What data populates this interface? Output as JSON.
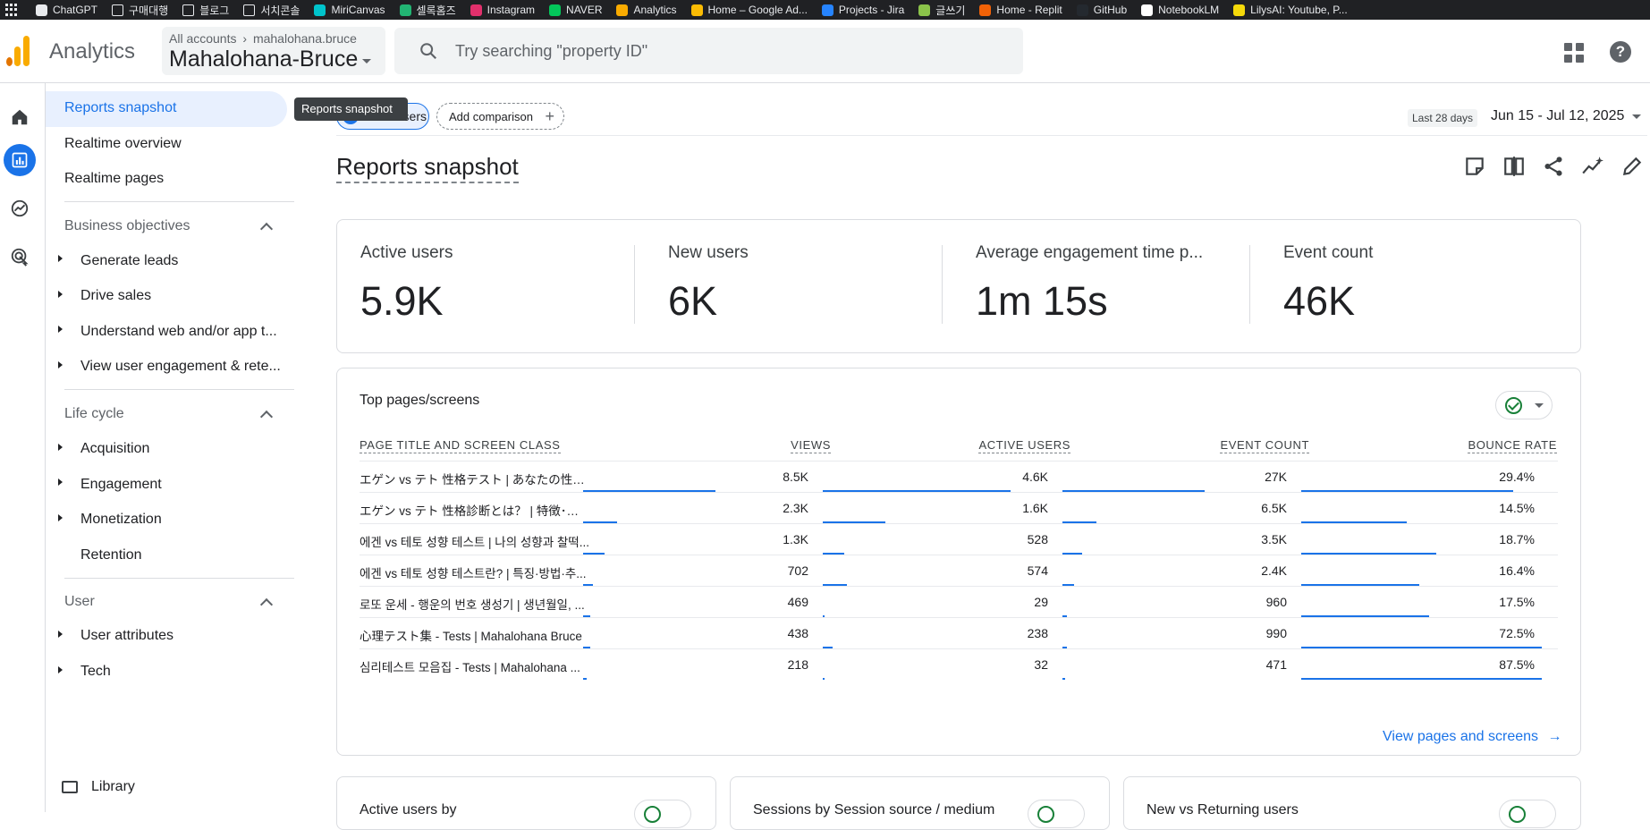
{
  "bookmarks": [
    {
      "label": "ChatGPT",
      "color": "#e8eaed",
      "folder": false
    },
    {
      "label": "구매대행",
      "color": "",
      "folder": true
    },
    {
      "label": "블로그",
      "color": "",
      "folder": true
    },
    {
      "label": "서치콘솔",
      "color": "",
      "folder": true
    },
    {
      "label": "MiriCanvas",
      "color": "#00c4cc",
      "folder": false
    },
    {
      "label": "셀록홈즈",
      "color": "#22b573",
      "folder": false
    },
    {
      "label": "Instagram",
      "color": "#e1306c",
      "folder": false
    },
    {
      "label": "NAVER",
      "color": "#03c75a",
      "folder": false
    },
    {
      "label": "Analytics",
      "color": "#f9ab00",
      "folder": false
    },
    {
      "label": "Home – Google Ad...",
      "color": "#fbbc04",
      "folder": false
    },
    {
      "label": "Projects - Jira",
      "color": "#2684ff",
      "folder": false
    },
    {
      "label": "글쓰기",
      "color": "#8bc34a",
      "folder": false
    },
    {
      "label": "Home - Replit",
      "color": "#f26207",
      "folder": false
    },
    {
      "label": "GitHub",
      "color": "#24292f",
      "folder": false
    },
    {
      "label": "NotebookLM",
      "color": "#ffffff",
      "folder": false
    },
    {
      "label": "LilysAI: Youtube, P...",
      "color": "#f5d90a",
      "folder": false
    }
  ],
  "header": {
    "app_name": "Analytics",
    "account_path": "All accounts",
    "account_sub": "mahalohana.bruce",
    "property_name": "Mahalohana-Bruce",
    "search_placeholder": "Try searching \"property ID\""
  },
  "nav": {
    "top_items": [
      "Reports snapshot",
      "Realtime overview",
      "Realtime pages"
    ],
    "business_objectives": {
      "title": "Business objectives",
      "items": [
        "Generate leads",
        "Drive sales",
        "Understand web and/or app t...",
        "View user engagement & rete..."
      ]
    },
    "life_cycle": {
      "title": "Life cycle",
      "items": [
        "Acquisition",
        "Engagement",
        "Monetization",
        "Retention"
      ]
    },
    "user": {
      "title": "User",
      "items": [
        "User attributes",
        "Tech"
      ]
    },
    "library": "Library",
    "tooltip": "Reports snapshot"
  },
  "toolbar": {
    "all_users_chip": "All Users",
    "add_comparison": "Add comparison",
    "date_label": "Last 28 days",
    "date_range": "Jun 15 - Jul 12, 2025"
  },
  "page_title": "Reports snapshot",
  "metrics": [
    {
      "label": "Active users",
      "value": "5.9K"
    },
    {
      "label": "New users",
      "value": "6K"
    },
    {
      "label": "Average engagement time p...",
      "value": "1m 15s"
    },
    {
      "label": "Event count",
      "value": "46K"
    }
  ],
  "top_pages": {
    "title": "Top pages/screens",
    "columns": [
      "PAGE TITLE AND SCREEN CLASS",
      "VIEWS",
      "ACTIVE USERS",
      "EVENT COUNT",
      "BOUNCE RATE"
    ],
    "rows": [
      {
        "title": "エゲン vs テト 性格テスト | あなたの性格と...",
        "views": "8.5K",
        "active_users": "4.6K",
        "event_count": "27K",
        "bounce_rate": "29.4%",
        "bars": [
          0.55,
          0.78,
          0.59,
          0.88
        ]
      },
      {
        "title": "エゲン vs テト 性格診断とは？ | 特徴･やり...",
        "views": "2.3K",
        "active_users": "1.6K",
        "event_count": "6.5K",
        "bounce_rate": "14.5%",
        "bars": [
          0.14,
          0.26,
          0.14,
          0.44
        ]
      },
      {
        "title": "에겐 vs 테토 성향 테스트 | 나의 성향과 찰떡...",
        "views": "1.3K",
        "active_users": "528",
        "event_count": "3.5K",
        "bounce_rate": "18.7%",
        "bars": [
          0.09,
          0.09,
          0.08,
          0.56
        ]
      },
      {
        "title": "에겐 vs 테토 성향 테스트란? | 특징·방법·추...",
        "views": "702",
        "active_users": "574",
        "event_count": "2.4K",
        "bounce_rate": "16.4%",
        "bars": [
          0.04,
          0.1,
          0.05,
          0.49
        ]
      },
      {
        "title": "로또 운세 - 행운의 번호 생성기 | 생년월일, ...",
        "views": "469",
        "active_users": "29",
        "event_count": "960",
        "bounce_rate": "17.5%",
        "bars": [
          0.03,
          0.005,
          0.02,
          0.53
        ]
      },
      {
        "title": "心理テスト集 - Tests | Mahalohana Bruce",
        "views": "438",
        "active_users": "238",
        "event_count": "990",
        "bounce_rate": "72.5%",
        "bars": [
          0.03,
          0.04,
          0.02,
          1.0
        ]
      },
      {
        "title": "심리테스트 모음집 - Tests | Mahalohana ...",
        "views": "218",
        "active_users": "32",
        "event_count": "471",
        "bounce_rate": "87.5%",
        "bars": [
          0.015,
          0.005,
          0.01,
          1.0
        ]
      }
    ],
    "link": "View pages and screens"
  },
  "bottom_cards": [
    {
      "title": "Active users by"
    },
    {
      "title": "Sessions by Session source / medium"
    },
    {
      "title": "New vs Returning users"
    }
  ]
}
